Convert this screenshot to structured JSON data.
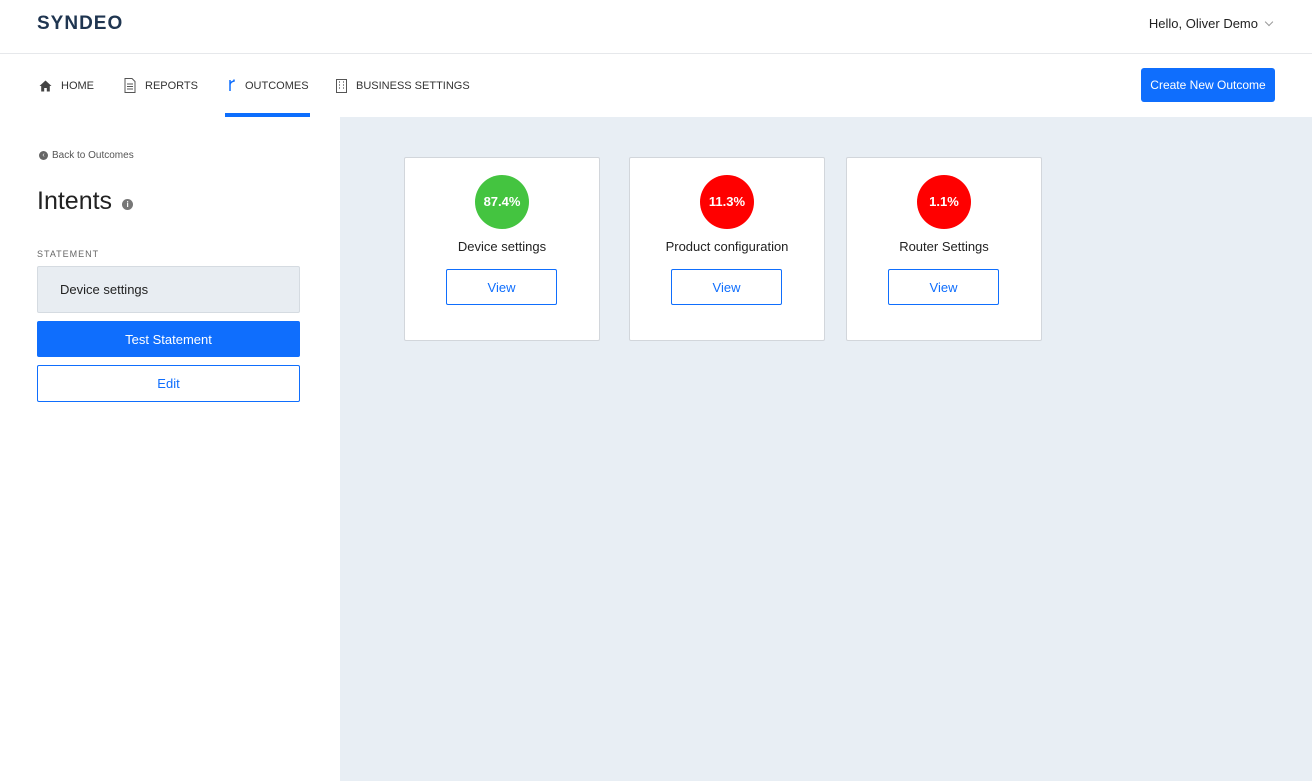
{
  "header": {
    "logo": "SYNDEO",
    "user_greeting": "Hello, Oliver Demo"
  },
  "nav": {
    "items": [
      {
        "label": "HOME",
        "icon": "home-icon"
      },
      {
        "label": "REPORTS",
        "icon": "document-icon"
      },
      {
        "label": "OUTCOMES",
        "icon": "branch-icon",
        "active": true
      },
      {
        "label": "BUSINESS SETTINGS",
        "icon": "building-icon"
      }
    ],
    "create_button": "Create New Outcome"
  },
  "sidebar": {
    "back_link": "Back to Outcomes",
    "title": "Intents",
    "statement_label": "STATEMENT",
    "statement_value": "Device settings",
    "test_button": "Test Statement",
    "edit_button": "Edit"
  },
  "results": [
    {
      "score": "87.4%",
      "label": "Device settings",
      "color": "#44c440",
      "button": "View"
    },
    {
      "score": "11.3%",
      "label": "Product configuration",
      "color": "#ff0000",
      "button": "View"
    },
    {
      "score": "1.1%",
      "label": "Router Settings",
      "color": "#ff0000",
      "button": "View"
    }
  ],
  "colors": {
    "accent": "#0f6efd",
    "main_background": "#e8eef4"
  }
}
